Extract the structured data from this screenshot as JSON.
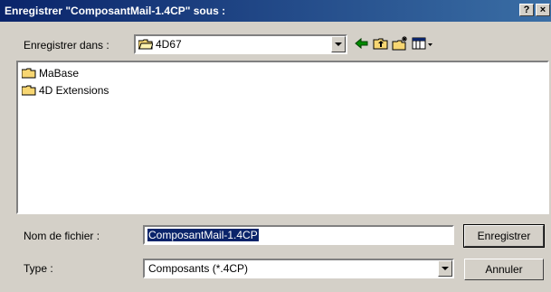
{
  "window": {
    "title": "Enregistrer \"ComposantMail-1.4CP\" sous :",
    "help_label": "?",
    "close_label": "×"
  },
  "location": {
    "label": "Enregistrer dans :",
    "current_folder": "4D67"
  },
  "files": [
    {
      "name": "MaBase"
    },
    {
      "name": "4D Extensions"
    }
  ],
  "filename": {
    "label": "Nom de fichier :",
    "value": "ComposantMail-1.4CP"
  },
  "type": {
    "label": "Type :",
    "value": "Composants (*.4CP)"
  },
  "buttons": {
    "save": "Enregistrer",
    "cancel": "Annuler"
  },
  "colors": {
    "title_start": "#0a246a",
    "title_end": "#3a6ea5",
    "face": "#d4d0c8",
    "folder": "#f7d672",
    "selection": "#0a246a"
  }
}
